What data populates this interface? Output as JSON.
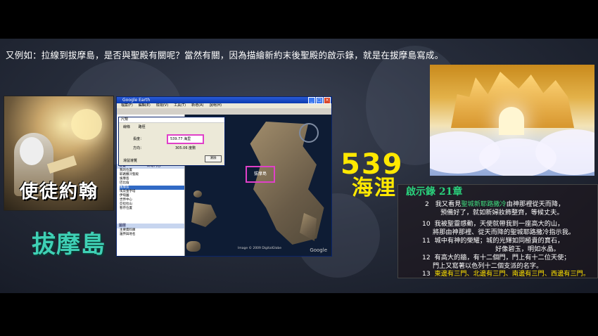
{
  "caption": "又例如：拉線到拔摩島，是否與聖殿有關呢？當然有關，因為描繪新約末後聖殿的啟示錄，就是在拔摩島寫成。",
  "john_title": "使徒約翰",
  "patmos_label": "拔摩島",
  "google_earth": {
    "window_title": "Google Earth",
    "menu": [
      "檔案(F)",
      "編輯(E)",
      "檢視(V)",
      "工具(T)",
      "新增(A)",
      "說明(H)"
    ],
    "dialog_title": "尺規",
    "dialog_tabs": [
      "線條",
      "路徑"
    ],
    "length_label": "長度：",
    "length_value": "539.77 海里",
    "heading_label": "方向：",
    "heading_value": "305.06 度數",
    "mouse_nav_label": "滑鼠導覽",
    "save_button": "清除",
    "places_head": "位置",
    "add_content": "新增內容",
    "places": [
      "我的位置",
      "耶路撒冷聖殿",
      "拔摩島",
      "巴比倫",
      "拔摩島",
      "埃及金字塔",
      "伊甸園",
      "世界中心",
      "亞拉拉山",
      "暫存位置"
    ],
    "layers_head": "圖層",
    "layers": [
      "主要資料庫",
      "邊界與地名"
    ],
    "map_label": "拔摩島",
    "copyright": "Image © 2009 DigitalGlobe",
    "google_logo": "Google"
  },
  "distance_number": "539",
  "distance_unit": "海浬",
  "revelation": {
    "title": "啟示錄 21章",
    "verses": [
      {
        "num": "2",
        "pre": "我又看見",
        "highlight": "聖城新耶路撒冷",
        "post": "由神那裡從天而降，"
      },
      {
        "num": "",
        "pre": "預備好了，就如新婦妝飾整齊，等候丈夫。",
        "highlight": "",
        "post": ""
      },
      {
        "num": "10",
        "pre": "我被聖靈感動，天使就帶我到一座高大的山，",
        "highlight": "",
        "post": ""
      },
      {
        "num": "",
        "pre": "將那由神那裡、從天而降的聖城耶路撒冷指示我。",
        "highlight": "",
        "post": ""
      },
      {
        "num": "11",
        "pre": "城中有神的榮耀；城的光輝如同極貴的寶石，",
        "highlight": "",
        "post": ""
      },
      {
        "num": "",
        "pre": "好像碧玉，明如水晶。",
        "highlight": "",
        "post": ""
      },
      {
        "num": "12",
        "pre": "有高大的牆，有十二個門，門上有十二位天使；",
        "highlight": "",
        "post": ""
      },
      {
        "num": "",
        "pre": "門上又寫著以色列十二個支派的名字。",
        "highlight": "",
        "post": ""
      },
      {
        "num": "13",
        "pre": "東邊有三門、北邊有三門、南邊有三門、西邊有三門。",
        "highlight": "",
        "post": ""
      }
    ]
  },
  "colors": {
    "accent_yellow": "#ffe800",
    "teal": "#3fd0b5",
    "green": "#2ad17c",
    "highlight_pink": "#e040c8"
  }
}
